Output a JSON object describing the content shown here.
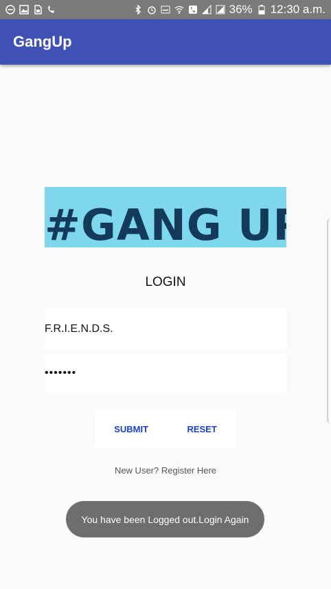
{
  "status_bar": {
    "battery": "36%",
    "time": "12:30 a.m.",
    "icons_left": [
      "minus-circle-icon",
      "image-icon",
      "sim-icon",
      "missed-call-icon"
    ],
    "icons_right": [
      "bluetooth-icon",
      "alarm-icon",
      "volte-icon",
      "wifi-icon",
      "phone-icon",
      "signal-icon",
      "signal-icon",
      "battery-icon"
    ]
  },
  "app_bar": {
    "title": "GangUp",
    "color": "#3f51b5"
  },
  "banner": {
    "text": "#GANG UP"
  },
  "login": {
    "title": "LOGIN",
    "username_value": "F.R.I.E.N.D.S.",
    "password_value": "•••••••",
    "submit_label": "SUBMIT",
    "reset_label": "RESET",
    "register_text": "New User? Register Here"
  },
  "toast": {
    "message": "You have been Logged out.Login Again"
  }
}
